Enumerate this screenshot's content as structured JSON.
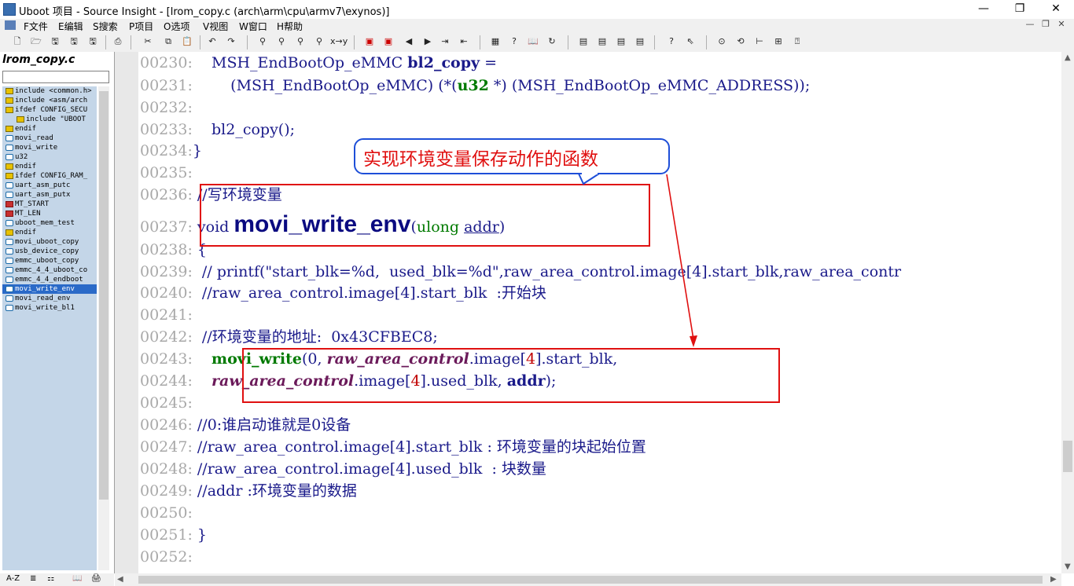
{
  "window": {
    "title": "Uboot 项目 - Source Insight - [lrom_copy.c (arch\\arm\\cpu\\armv7\\exynos)]",
    "min": "—",
    "max": "❐",
    "close": "✕"
  },
  "menu": [
    {
      "label": "F文件"
    },
    {
      "label": "E编辑"
    },
    {
      "label": "S搜索"
    },
    {
      "label": "P项目"
    },
    {
      "label": "O选项"
    },
    {
      "label": "V视图"
    },
    {
      "label": "W窗口"
    },
    {
      "label": "H帮助"
    }
  ],
  "mdi": {
    "min": "—",
    "restore": "❐",
    "close": "✕"
  },
  "sidebar": {
    "title": "lrom_copy.c",
    "items": [
      {
        "label": "include <common.h>",
        "icon": "inc",
        "indent": false,
        "selected": false
      },
      {
        "label": "include <asm/arch",
        "icon": "inc",
        "indent": false,
        "selected": false
      },
      {
        "label": "ifdef CONFIG_SECU",
        "icon": "inc",
        "indent": false,
        "selected": false
      },
      {
        "label": "include \"UBOOT",
        "icon": "inc",
        "indent": true,
        "selected": false
      },
      {
        "label": "endif",
        "icon": "inc",
        "indent": false,
        "selected": false
      },
      {
        "label": "movi_read",
        "icon": "fn",
        "indent": false,
        "selected": false
      },
      {
        "label": "movi_write",
        "icon": "fn",
        "indent": false,
        "selected": false
      },
      {
        "label": "u32",
        "icon": "fn",
        "indent": false,
        "selected": false
      },
      {
        "label": "endif",
        "icon": "inc",
        "indent": false,
        "selected": false
      },
      {
        "label": "ifdef CONFIG_RAM_",
        "icon": "inc",
        "indent": false,
        "selected": false
      },
      {
        "label": "uart_asm_putc",
        "icon": "fn",
        "indent": false,
        "selected": false
      },
      {
        "label": "uart_asm_putx",
        "icon": "fn",
        "indent": false,
        "selected": false
      },
      {
        "label": "MT_START",
        "icon": "def",
        "indent": false,
        "selected": false
      },
      {
        "label": "MT_LEN",
        "icon": "def",
        "indent": false,
        "selected": false
      },
      {
        "label": "uboot_mem_test",
        "icon": "fn",
        "indent": false,
        "selected": false
      },
      {
        "label": "endif",
        "icon": "inc",
        "indent": false,
        "selected": false
      },
      {
        "label": "movi_uboot_copy",
        "icon": "fn",
        "indent": false,
        "selected": false
      },
      {
        "label": "usb_device_copy",
        "icon": "fn",
        "indent": false,
        "selected": false
      },
      {
        "label": "emmc_uboot_copy",
        "icon": "fn",
        "indent": false,
        "selected": false
      },
      {
        "label": "emmc_4_4_uboot_co",
        "icon": "fn",
        "indent": false,
        "selected": false
      },
      {
        "label": "emmc_4_4_endboot",
        "icon": "fn",
        "indent": false,
        "selected": false
      },
      {
        "label": "movi_write_env",
        "icon": "fn",
        "indent": false,
        "selected": true
      },
      {
        "label": "movi_read_env",
        "icon": "fn",
        "indent": false,
        "selected": false
      },
      {
        "label": "movi_write_bl1",
        "icon": "fn",
        "indent": false,
        "selected": false
      }
    ],
    "bottom_buttons": [
      "A-Z",
      "≣",
      "⚏",
      "📖",
      "🖨"
    ]
  },
  "code": {
    "l230": {
      "num": "00230:",
      "pre": "    MSH_EndBootOp_eMMC ",
      "name": "bl2_copy",
      "post": " ="
    },
    "l231": {
      "num": "00231:",
      "a": "        (MSH_EndBootOp_eMMC) (*(",
      "b": "u32",
      "c": " *) (MSH_EndBootOp_eMMC_ADDRESS));"
    },
    "l232": {
      "num": "00232:"
    },
    "l233": {
      "num": "00233:",
      "text": "    bl2_copy();"
    },
    "l234": {
      "num": "00234:",
      "text": "}"
    },
    "l235": {
      "num": "00235:"
    },
    "l236": {
      "num": "00236:",
      "text": "//写环境变量"
    },
    "l237": {
      "num": "00237:",
      "kw": "void ",
      "name": "movi_write_env",
      "open": "(",
      "type": "ulong",
      "sp": " ",
      "param": "addr",
      "close": ")"
    },
    "l238": {
      "num": "00238:",
      "text": "{"
    },
    "l239": {
      "num": "00239:",
      "text": " // printf(\"start_blk=%d,  used_blk=%d\",raw_area_control.image[4].start_blk,raw_area_contr"
    },
    "l240": {
      "num": "00240:",
      "text": " //raw_area_control.image[4].start_blk  :开始块"
    },
    "l241": {
      "num": "00241:"
    },
    "l242": {
      "num": "00242:",
      "text": " //环境变量的地址:  0x43CFBEC8;"
    },
    "l243": {
      "num": "00243:",
      "a": "   ",
      "fn": "movi_write",
      "b": "(0, ",
      "c": "raw_area_control",
      "d": ".image[",
      "e": "4",
      "f": "].start_blk,"
    },
    "l244": {
      "num": "00244:",
      "a": "   ",
      "c": "raw_area_control",
      "d": ".image[",
      "e": "4",
      "f": "].used_blk, ",
      "g": "addr",
      "h": ");"
    },
    "l245": {
      "num": "00245:"
    },
    "l246": {
      "num": "00246:",
      "text": "//0:谁启动谁就是0设备"
    },
    "l247": {
      "num": "00247:",
      "text": "//raw_area_control.image[4].start_blk : 环境变量的块起始位置"
    },
    "l248": {
      "num": "00248:",
      "text": "//raw_area_control.image[4].used_blk  : 块数量"
    },
    "l249": {
      "num": "00249:",
      "text": "//addr :环境变量的数据"
    },
    "l250": {
      "num": "00250:"
    },
    "l251": {
      "num": "00251:",
      "text": "}"
    },
    "l252": {
      "num": "00252:"
    }
  },
  "annotation": {
    "callout": "实现环境变量保存动作的函数",
    "color_text": "#e01010",
    "color_border": "#1e4fd8"
  }
}
